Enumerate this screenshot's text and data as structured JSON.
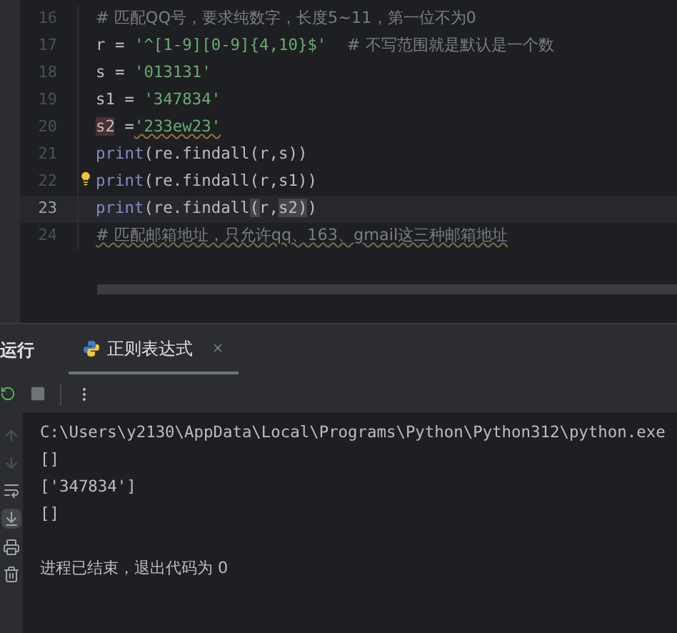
{
  "editor": {
    "lines": [
      {
        "number": "16",
        "current": false,
        "segments": [
          {
            "text": "# 匹配QQ号，要求纯数字，长度5~11，第一位不为0",
            "kind": "comment"
          }
        ]
      },
      {
        "number": "17",
        "current": false,
        "segments": [
          {
            "text": "r = ",
            "kind": "plain"
          },
          {
            "text": "'^[1-9][0-9]{4,10}$'",
            "kind": "string"
          },
          {
            "text": "    # 不写范围就是默认是一个数",
            "kind": "comment"
          }
        ]
      },
      {
        "number": "18",
        "current": false,
        "segments": [
          {
            "text": "s = ",
            "kind": "plain"
          },
          {
            "text": "'013131'",
            "kind": "string"
          }
        ]
      },
      {
        "number": "19",
        "current": false,
        "segments": [
          {
            "text": "s1 = ",
            "kind": "plain"
          },
          {
            "text": "'347834'",
            "kind": "string"
          }
        ]
      },
      {
        "number": "20",
        "current": false,
        "segments": [
          {
            "text": "s2",
            "kind": "highlight"
          },
          {
            "text": " =",
            "kind": "plain"
          },
          {
            "text": "'233ew23'",
            "kind": "string_warn"
          }
        ]
      },
      {
        "number": "21",
        "current": false,
        "segments": [
          {
            "text": "print",
            "kind": "builtin"
          },
          {
            "text": "(re.findall(r,s))",
            "kind": "plain"
          }
        ]
      },
      {
        "number": "22",
        "current": false,
        "bulb": true,
        "segments": [
          {
            "text": "print",
            "kind": "builtin"
          },
          {
            "text": "(re.findall(r,s1))",
            "kind": "plain"
          }
        ]
      },
      {
        "number": "23",
        "current": true,
        "segments": [
          {
            "text": "print",
            "kind": "builtin"
          },
          {
            "text": "(re.findall",
            "kind": "plain"
          },
          {
            "text": "(",
            "kind": "match"
          },
          {
            "text": "r,",
            "kind": "plain"
          },
          {
            "text": "s2)",
            "kind": "match"
          },
          {
            "text": ")",
            "kind": "plain"
          }
        ]
      },
      {
        "number": "24",
        "current": false,
        "segments": [
          {
            "text": "# 匹配邮箱地址，只允许qq、163、gmail这三种邮箱地址",
            "kind": "comment_warn"
          }
        ]
      }
    ]
  },
  "run_panel": {
    "title": "运行",
    "tabs": [
      {
        "label": "正则表达式",
        "selected": true
      }
    ]
  },
  "console": {
    "lines": [
      {
        "text": "C:\\Users\\y2130\\AppData\\Local\\Programs\\Python\\Python312\\python.exe",
        "kind": "output"
      },
      {
        "text": "[]",
        "kind": "output"
      },
      {
        "text": "['347834']",
        "kind": "output"
      },
      {
        "text": "[]",
        "kind": "output"
      },
      {
        "text": "进程已结束，退出代码为 0",
        "kind": "status"
      }
    ]
  }
}
